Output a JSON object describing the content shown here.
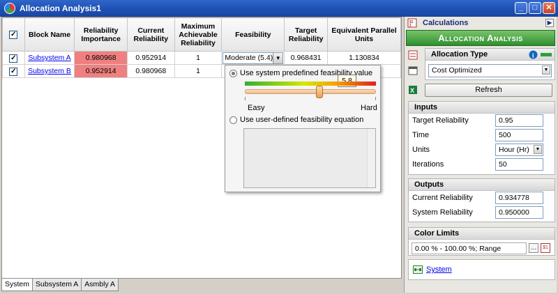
{
  "window": {
    "title": "Allocation Analysis1"
  },
  "grid": {
    "headers": {
      "block_name": "Block Name",
      "reliability_importance": "Reliability Importance",
      "current_reliability": "Current Reliability",
      "max_achievable": "Maximum Achievable Reliability",
      "feasibility": "Feasibility",
      "target_reliability": "Target Reliability",
      "equiv_parallel": "Equivalent Parallel Units"
    },
    "rows": [
      {
        "name": "Subsystem A",
        "importance": "0.980968",
        "current": "0.952914",
        "max": "1",
        "feasibility": "Moderate (5.4)",
        "target": "0.968431",
        "equiv": "1.130834"
      },
      {
        "name": "Subsystem B",
        "importance": "0.952914",
        "current": "0.980968",
        "max": "1"
      }
    ]
  },
  "popup": {
    "option1": "Use system predefined feasibility value",
    "tooltip_value": "5.8",
    "slider_value": 5.8,
    "easy": "Easy",
    "hard": "Hard",
    "option2": "Use user-defined feasibility equation"
  },
  "tabs": [
    "System",
    "Subsystem A",
    "Asmbly A"
  ],
  "panel": {
    "calculations": "Calculations",
    "banner": "Allocation Analysis",
    "allocation_type_label": "Allocation Type",
    "allocation_type_value": "Cost Optimized",
    "refresh": "Refresh",
    "inputs": {
      "title": "Inputs",
      "target_reliability_label": "Target Reliability",
      "target_reliability": "0.95",
      "time_label": "Time",
      "time": "500",
      "units_label": "Units",
      "units": "Hour (Hr)",
      "iterations_label": "Iterations",
      "iterations": "50"
    },
    "outputs": {
      "title": "Outputs",
      "current_reliability_label": "Current Reliability",
      "current_reliability": "0.934778",
      "system_reliability_label": "System Reliability",
      "system_reliability": "0.950000"
    },
    "color_limits": {
      "title": "Color Limits",
      "value": "0.00 % - 100.00 %; Range"
    },
    "system_link": "System"
  },
  "colors": {
    "importance_fill": "#f08080",
    "banner": "#2f8f2f",
    "title_bar": "#1d4fb3"
  }
}
